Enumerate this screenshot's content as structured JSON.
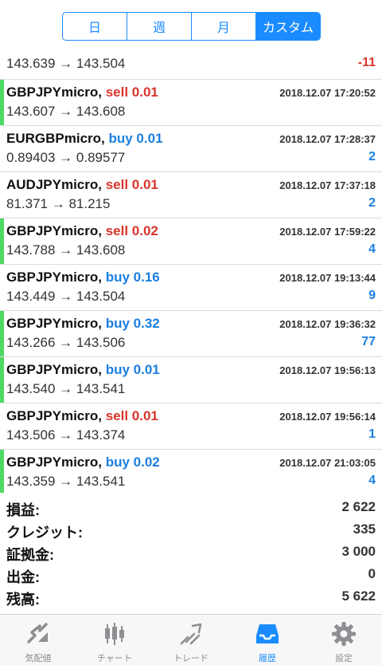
{
  "segments": [
    "日",
    "週",
    "月",
    "カスタム"
  ],
  "active_segment": 3,
  "partial_deal": {
    "prices": "143.639 → 143.504",
    "profit": "-11",
    "profit_type": "neg"
  },
  "deals": [
    {
      "symbol": "GBPJPYmicro",
      "side": "sell 0.01",
      "side_type": "sell",
      "time": "2018.12.07 17:20:52",
      "prices": "143.607 → 143.608",
      "profit": "",
      "profit_type": "pos",
      "marker": true
    },
    {
      "symbol": "EURGBPmicro",
      "side": "buy 0.01",
      "side_type": "buy",
      "time": "2018.12.07 17:28:37",
      "prices": "0.89403 → 0.89577",
      "profit": "2",
      "profit_type": "pos",
      "marker": false
    },
    {
      "symbol": "AUDJPYmicro",
      "side": "sell 0.01",
      "side_type": "sell",
      "time": "2018.12.07 17:37:18",
      "prices": "81.371 → 81.215",
      "profit": "2",
      "profit_type": "pos",
      "marker": false
    },
    {
      "symbol": "GBPJPYmicro",
      "side": "sell 0.02",
      "side_type": "sell",
      "time": "2018.12.07 17:59:22",
      "prices": "143.788 → 143.608",
      "profit": "4",
      "profit_type": "pos",
      "marker": true
    },
    {
      "symbol": "GBPJPYmicro",
      "side": "buy 0.16",
      "side_type": "buy",
      "time": "2018.12.07 19:13:44",
      "prices": "143.449 → 143.504",
      "profit": "9",
      "profit_type": "pos",
      "marker": false
    },
    {
      "symbol": "GBPJPYmicro",
      "side": "buy 0.32",
      "side_type": "buy",
      "time": "2018.12.07 19:36:32",
      "prices": "143.266 → 143.506",
      "profit": "77",
      "profit_type": "pos",
      "marker": true
    },
    {
      "symbol": "GBPJPYmicro",
      "side": "buy 0.01",
      "side_type": "buy",
      "time": "2018.12.07 19:56:13",
      "prices": "143.540 → 143.541",
      "profit": "",
      "profit_type": "pos",
      "marker": true
    },
    {
      "symbol": "GBPJPYmicro",
      "side": "sell 0.01",
      "side_type": "sell",
      "time": "2018.12.07 19:56:14",
      "prices": "143.506 → 143.374",
      "profit": "1",
      "profit_type": "pos",
      "marker": false
    },
    {
      "symbol": "GBPJPYmicro",
      "side": "buy 0.02",
      "side_type": "buy",
      "time": "2018.12.07 21:03:05",
      "prices": "143.359 → 143.541",
      "profit": "4",
      "profit_type": "pos",
      "marker": true
    }
  ],
  "summary": [
    {
      "label": "損益:",
      "value": "2 622"
    },
    {
      "label": "クレジット:",
      "value": "335"
    },
    {
      "label": "証拠金:",
      "value": "3 000"
    },
    {
      "label": "出金:",
      "value": "0"
    },
    {
      "label": "残高:",
      "value": "5 622"
    }
  ],
  "tabs": [
    {
      "label": "気配値",
      "icon": "quotes-icon"
    },
    {
      "label": "チャート",
      "icon": "chart-icon"
    },
    {
      "label": "トレード",
      "icon": "trade-icon"
    },
    {
      "label": "履歴",
      "icon": "history-icon"
    },
    {
      "label": "設定",
      "icon": "settings-icon"
    }
  ],
  "active_tab": 3,
  "colors": {
    "accent": "#1a8cff",
    "sell": "#d9342b",
    "buy": "#1a7fe0",
    "marker": "#4cd964",
    "inactive": "#8e8e93"
  }
}
